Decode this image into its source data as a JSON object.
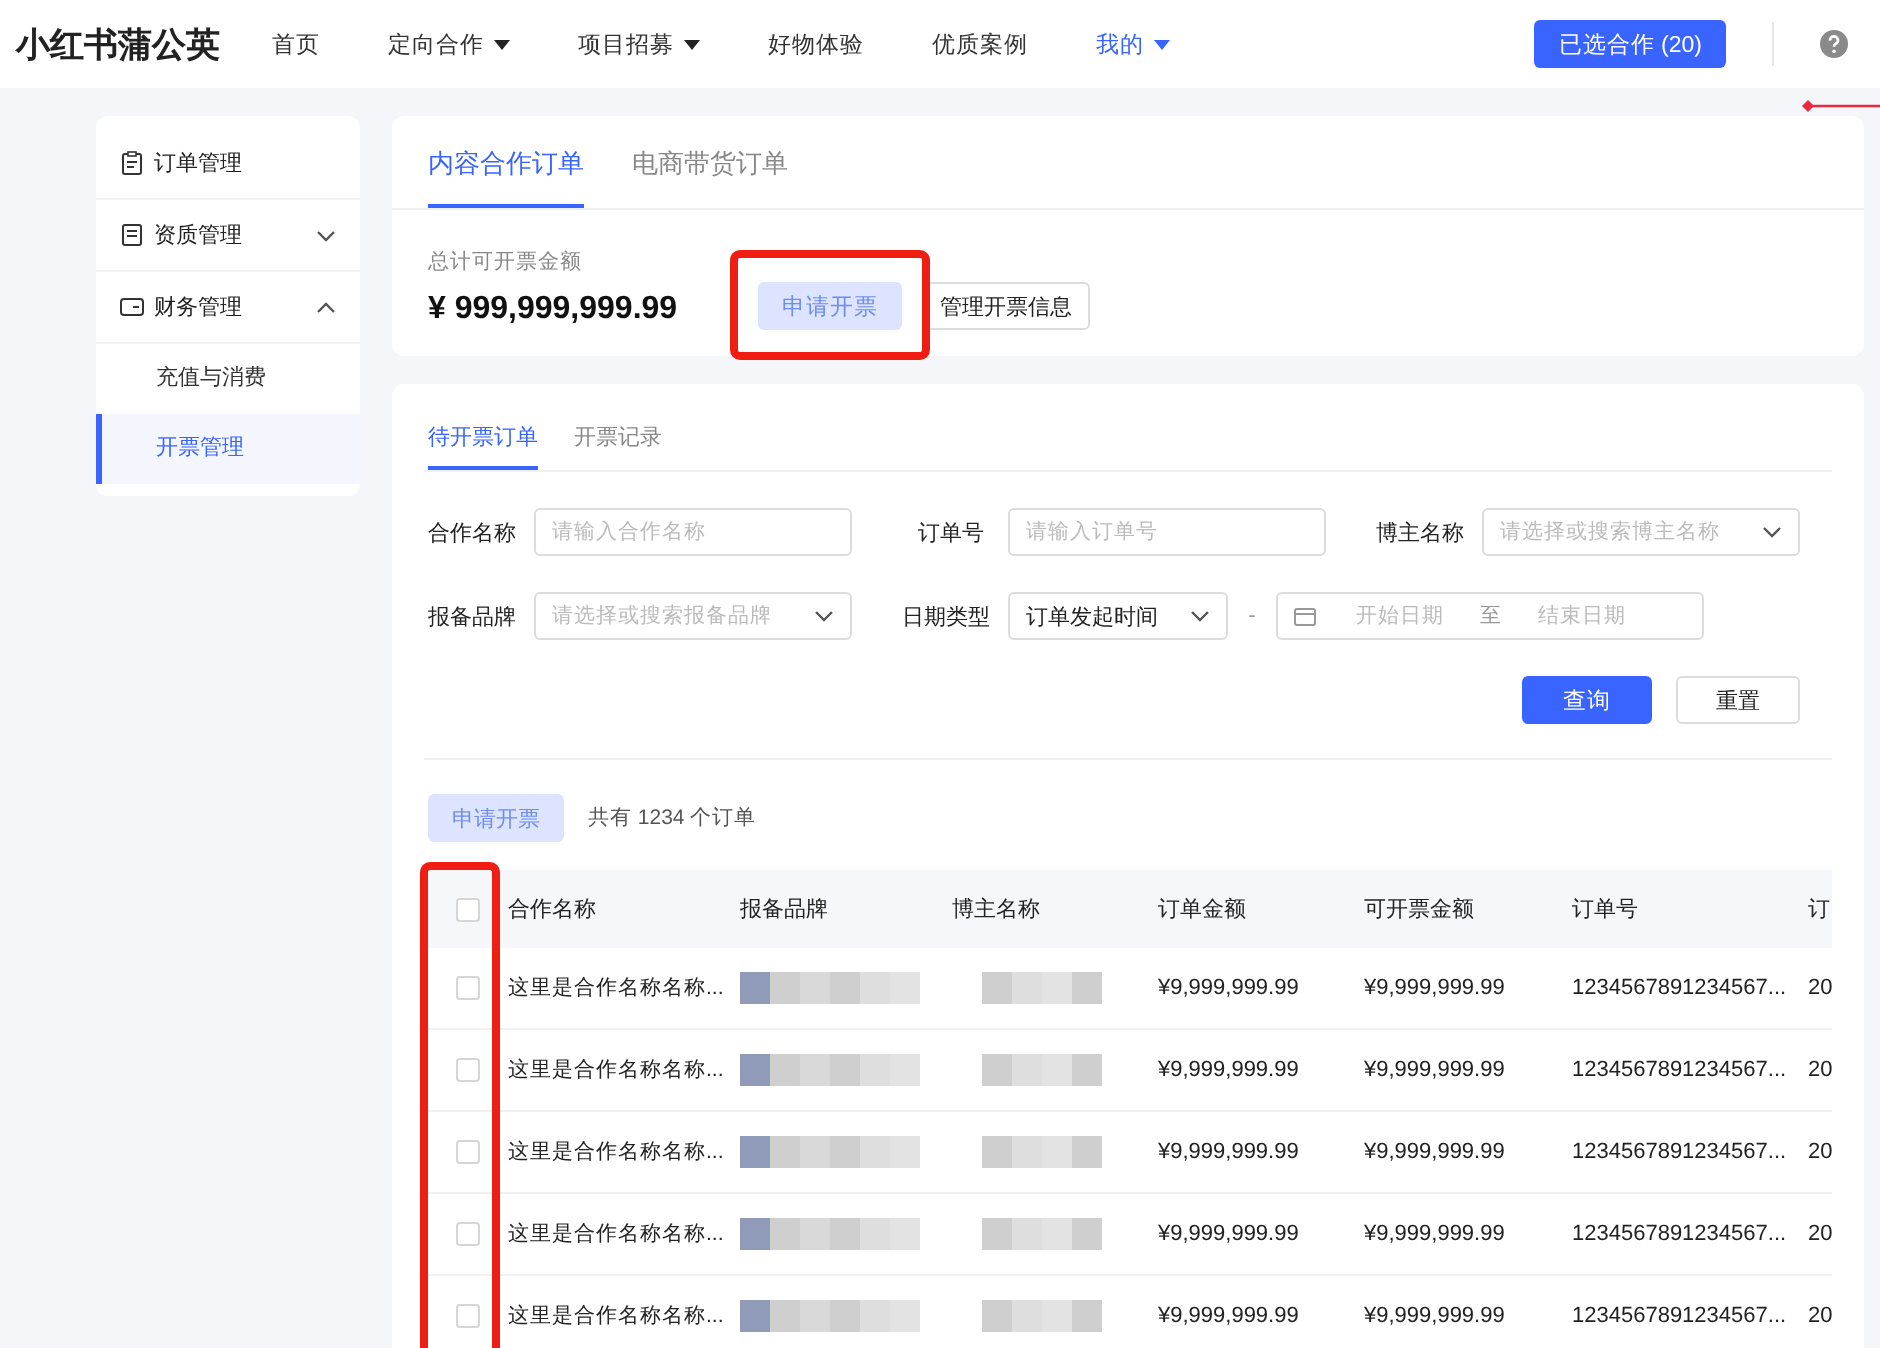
{
  "logo": "小红书蒲公英",
  "nav": [
    {
      "label": "首页",
      "dropdown": false,
      "selected": false
    },
    {
      "label": "定向合作",
      "dropdown": true,
      "selected": false
    },
    {
      "label": "项目招募",
      "dropdown": true,
      "selected": false
    },
    {
      "label": "好物体验",
      "dropdown": false,
      "selected": false
    },
    {
      "label": "优质案例",
      "dropdown": false,
      "selected": false
    },
    {
      "label": "我的",
      "dropdown": true,
      "selected": true
    }
  ],
  "header_button": "已选合作 (20)",
  "annotation_marker": true,
  "sidebar": {
    "items": [
      {
        "label": "订单管理",
        "kind": "link",
        "selected": false
      },
      {
        "label": "资质管理",
        "kind": "group",
        "expanded": false
      },
      {
        "label": "财务管理",
        "kind": "group",
        "expanded": true,
        "children": [
          {
            "label": "充值与消费",
            "selected": false
          },
          {
            "label": "开票管理",
            "selected": true
          }
        ]
      }
    ]
  },
  "tabs": [
    {
      "label": "内容合作订单",
      "selected": true
    },
    {
      "label": "电商带货订单",
      "selected": false
    }
  ],
  "summary": {
    "label": "总计可开票金额",
    "amount": "¥ 999,999,999.99",
    "apply_button": {
      "label": "申请开票",
      "disabled": true,
      "highlighted": true
    },
    "manage_button": "管理开票信息"
  },
  "sub_tabs": [
    {
      "label": "待开票订单",
      "selected": true
    },
    {
      "label": "开票记录",
      "selected": false
    }
  ],
  "filters": [
    {
      "kind": "text",
      "label": "合作名称",
      "placeholder": "请输入合作名称"
    },
    {
      "kind": "text",
      "label": "订单号",
      "placeholder": "请输入订单号"
    },
    {
      "kind": "select",
      "label": "博主名称",
      "placeholder": "请选择或搜索博主名称"
    },
    {
      "kind": "select",
      "label": "报备品牌",
      "placeholder": "请选择或搜索报备品牌"
    },
    {
      "kind": "daterange",
      "label": "日期类型",
      "value": "订单发起时间",
      "separator": "-",
      "start_placeholder": "开始日期",
      "to": "至",
      "end_placeholder": "结束日期"
    }
  ],
  "query_button": "查询",
  "reset_button": "重置",
  "batch": {
    "button": {
      "label": "申请开票",
      "disabled": true
    },
    "count_text": "共有 1234 个订单"
  },
  "table": {
    "checkbox_column_highlighted": true,
    "header_checked": false,
    "columns": [
      "合作名称",
      "报备品牌",
      "博主名称",
      "订单金额",
      "可开票金额",
      "订单号",
      "订"
    ],
    "rows": [
      {
        "checked": false,
        "name": "这里是合作名称名称...",
        "brand_redacted": true,
        "blogger_redacted": true,
        "amount": "¥9,999,999.99",
        "invoiceable": "¥9,999,999.99",
        "order_no": "1234567891234567...",
        "column_7": "20"
      },
      {
        "checked": false,
        "name": "这里是合作名称名称...",
        "brand_redacted": true,
        "blogger_redacted": true,
        "amount": "¥9,999,999.99",
        "invoiceable": "¥9,999,999.99",
        "order_no": "1234567891234567...",
        "column_7": "20"
      },
      {
        "checked": false,
        "name": "这里是合作名称名称...",
        "brand_redacted": true,
        "blogger_redacted": true,
        "amount": "¥9,999,999.99",
        "invoiceable": "¥9,999,999.99",
        "order_no": "1234567891234567...",
        "column_7": "20"
      },
      {
        "checked": false,
        "name": "这里是合作名称名称...",
        "brand_redacted": true,
        "blogger_redacted": true,
        "amount": "¥9,999,999.99",
        "invoiceable": "¥9,999,999.99",
        "order_no": "1234567891234567...",
        "column_7": "20"
      },
      {
        "checked": false,
        "name": "这里是合作名称名称...",
        "brand_redacted": true,
        "blogger_redacted": true,
        "amount": "¥9,999,999.99",
        "invoiceable": "¥9,999,999.99",
        "order_no": "1234567891234567...",
        "column_7": "20"
      }
    ]
  }
}
